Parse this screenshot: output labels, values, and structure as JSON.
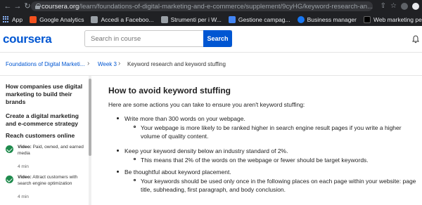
{
  "browser": {
    "url_host": "coursera.org",
    "url_path": "/learn/foundations-of-digital-marketing-and-e-commerce/supplement/9cyHG/keyword-research-an...",
    "bookmarks": [
      {
        "label": "App",
        "icon": "apps-grid-icon",
        "color": "#8ab4f8"
      },
      {
        "label": "Google Analytics",
        "icon": "google-analytics-icon",
        "color": "#f4511e"
      },
      {
        "label": "Accedi a Faceboo...",
        "icon": "page-icon",
        "color": "#9aa0a6"
      },
      {
        "label": "Strumenti per i W...",
        "icon": "folder-icon",
        "color": "#9aa0a6"
      },
      {
        "label": "Gestione campag...",
        "icon": "google-ads-icon",
        "color": "#4285f4"
      },
      {
        "label": "Business manager",
        "icon": "facebook-icon",
        "color": "#1877f2"
      },
      {
        "label": "Web marketing pe...",
        "icon": "web-marketing-icon",
        "color": "#000000"
      }
    ]
  },
  "header": {
    "logo": "coursera",
    "search_placeholder": "Search in course",
    "search_button": "Search"
  },
  "breadcrumb": {
    "course": "Foundations of Digital Marketi...",
    "week": "Week 3",
    "current": "Keyword research and keyword stuffing"
  },
  "sidebar": {
    "heading1": "How companies use digital marketing to build their brands",
    "heading2": "Create a digital marketing and e-commerce strategy",
    "heading3": "Reach customers online",
    "items": [
      {
        "type": "Video:",
        "title": "Paid, owned, and earned media",
        "duration": "4 min"
      },
      {
        "type": "Video:",
        "title": "Attract customers with search engine optimization",
        "duration": "4 min"
      }
    ]
  },
  "content": {
    "title": "How to avoid keyword stuffing",
    "intro": "Here are some actions you can take to ensure you aren't keyword stuffing:",
    "bullets": [
      {
        "text": "Write more than 300 words on your webpage.",
        "sub": "Your webpage is more likely to be ranked higher in search engine result pages if you write a higher volume of quality content."
      },
      {
        "text": "Keep your keyword density below an industry standard of 2%.",
        "sub": "This means that 2% of the words on the webpage or fewer should be target keywords."
      },
      {
        "text": "Be thoughtful about keyword placement.",
        "sub": "Your keywords should be used only once in the following places on each page within your website: page title, subheading, first paragraph, and body conclusion."
      }
    ]
  },
  "colors": {
    "brand": "#0056d2",
    "complete": "#1e8a4c"
  }
}
